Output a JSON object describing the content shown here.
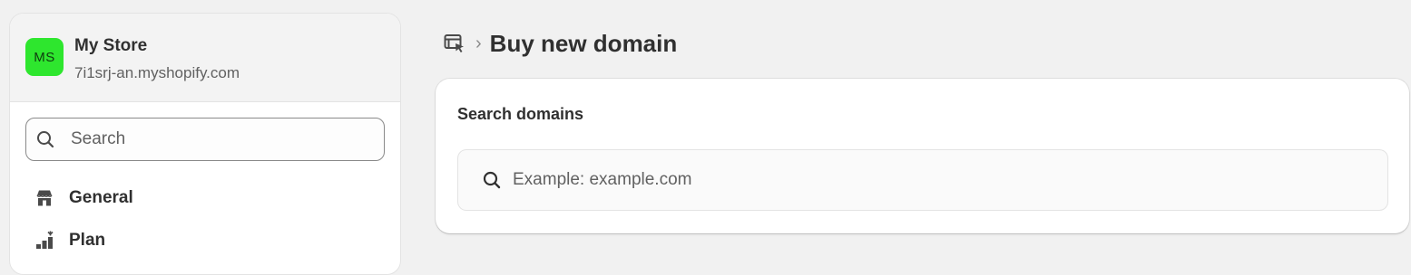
{
  "colors": {
    "store_avatar_bg": "#2ee62e",
    "background": "#f1f1f1",
    "text_primary": "#303030",
    "text_secondary": "#616161"
  },
  "sidebar": {
    "store": {
      "initials": "MS",
      "name": "My Store",
      "domain": "7i1srj-an.myshopify.com"
    },
    "search": {
      "icon": "search-icon",
      "placeholder": "Search",
      "value": ""
    },
    "items": [
      {
        "icon": "store-icon",
        "label": "General"
      },
      {
        "icon": "plan-icon",
        "label": "Plan"
      }
    ]
  },
  "main": {
    "breadcrumb": {
      "icon": "domains-icon",
      "separator": "›",
      "title": "Buy new domain"
    },
    "card": {
      "title": "Search domains",
      "search": {
        "icon": "search-icon",
        "placeholder": "Example: example.com",
        "value": ""
      }
    }
  }
}
